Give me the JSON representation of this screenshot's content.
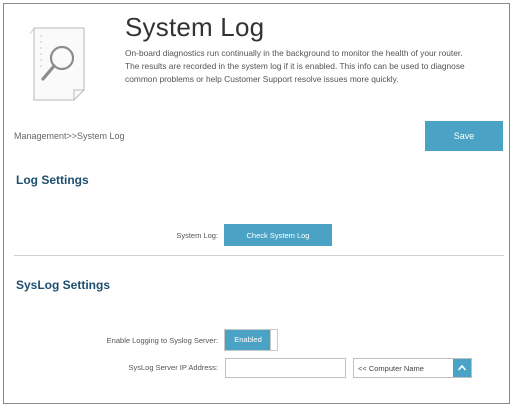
{
  "header": {
    "title": "System Log",
    "description": "On-board diagnostics run continually in the background to monitor the health of your router. The results are recorded in the system log if it is enabled. This info can be used to diagnose common problems or help Customer Support resolve issues more quickly.",
    "icon": "document-magnifier-icon"
  },
  "breadcrumb": "Management>>System Log",
  "toolbar": {
    "save_label": "Save"
  },
  "log_settings": {
    "title": "Log Settings",
    "system_log_label": "System Log:",
    "check_button_label": "Check System Log"
  },
  "syslog_settings": {
    "title": "SysLog Settings",
    "enable_label": "Enable Logging to Syslog Server:",
    "enable_value": "Enabled",
    "enable_state": true,
    "ip_label": "SysLog Server IP Address:",
    "ip_value": "",
    "computer_select_value": "<< Computer Name",
    "select_icon": "chevron-up-icon"
  },
  "colors": {
    "accent": "#4aa3c4",
    "section_title": "#1d4e6e"
  }
}
